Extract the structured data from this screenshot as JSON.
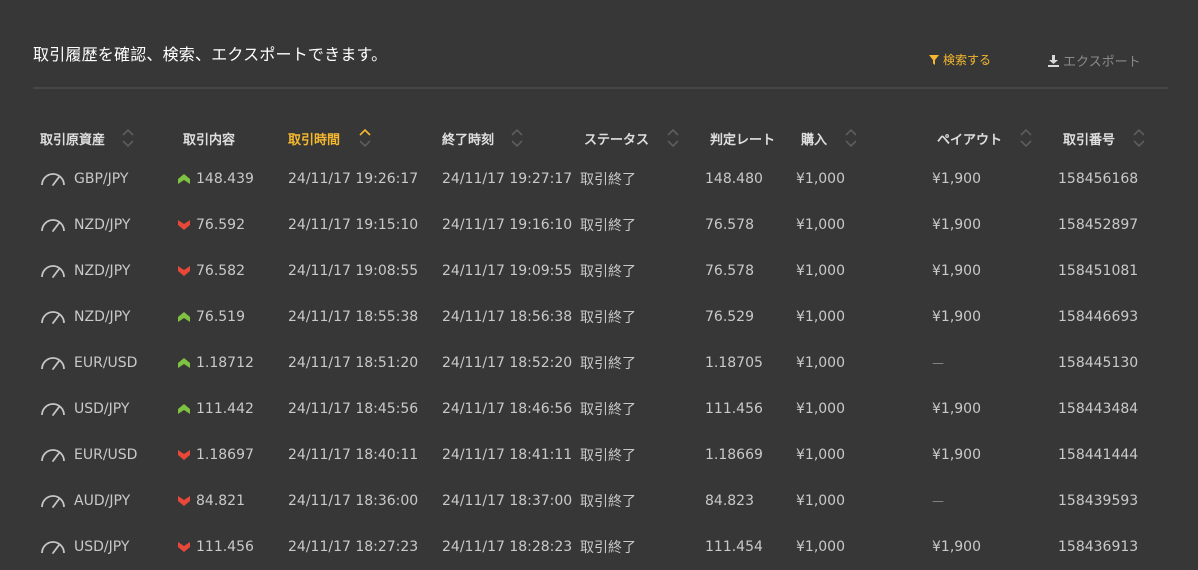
{
  "header": {
    "title": "取引履歴を確認、検索、エクスポートできます。",
    "search_label": "検索する",
    "export_label": "エクスポート"
  },
  "colors": {
    "accent": "#f5b82e",
    "up": "#7fc241",
    "down": "#e8483a"
  },
  "columns": [
    {
      "label": "取引原資産",
      "sortable": true,
      "active": false
    },
    {
      "label": "取引内容",
      "sortable": false,
      "active": false
    },
    {
      "label": "取引時間",
      "sortable": true,
      "active": true
    },
    {
      "label": "終了時刻",
      "sortable": true,
      "active": false
    },
    {
      "label": "ステータス",
      "sortable": true,
      "active": false
    },
    {
      "label": "判定レート",
      "sortable": false,
      "active": false
    },
    {
      "label": "購入",
      "sortable": true,
      "active": false
    },
    {
      "label": "ペイアウト",
      "sortable": true,
      "active": false
    },
    {
      "label": "取引番号",
      "sortable": true,
      "active": false
    }
  ],
  "rows": [
    {
      "asset": "GBP/JPY",
      "direction": "up",
      "entry": "148.439",
      "start": "24/11/17 19:26:17",
      "end": "24/11/17 19:27:17",
      "status": "取引終了",
      "rate": "148.480",
      "purchase": "¥1,000",
      "payout": "¥1,900",
      "id": "158456168"
    },
    {
      "asset": "NZD/JPY",
      "direction": "down",
      "entry": "76.592",
      "start": "24/11/17 19:15:10",
      "end": "24/11/17 19:16:10",
      "status": "取引終了",
      "rate": "76.578",
      "purchase": "¥1,000",
      "payout": "¥1,900",
      "id": "158452897"
    },
    {
      "asset": "NZD/JPY",
      "direction": "down",
      "entry": "76.582",
      "start": "24/11/17 19:08:55",
      "end": "24/11/17 19:09:55",
      "status": "取引終了",
      "rate": "76.578",
      "purchase": "¥1,000",
      "payout": "¥1,900",
      "id": "158451081"
    },
    {
      "asset": "NZD/JPY",
      "direction": "up",
      "entry": "76.519",
      "start": "24/11/17 18:55:38",
      "end": "24/11/17 18:56:38",
      "status": "取引終了",
      "rate": "76.529",
      "purchase": "¥1,000",
      "payout": "¥1,900",
      "id": "158446693"
    },
    {
      "asset": "EUR/USD",
      "direction": "up",
      "entry": "1.18712",
      "start": "24/11/17 18:51:20",
      "end": "24/11/17 18:52:20",
      "status": "取引終了",
      "rate": "1.18705",
      "purchase": "¥1,000",
      "payout": "—",
      "id": "158445130"
    },
    {
      "asset": "USD/JPY",
      "direction": "up",
      "entry": "111.442",
      "start": "24/11/17 18:45:56",
      "end": "24/11/17 18:46:56",
      "status": "取引終了",
      "rate": "111.456",
      "purchase": "¥1,000",
      "payout": "¥1,900",
      "id": "158443484"
    },
    {
      "asset": "EUR/USD",
      "direction": "down",
      "entry": "1.18697",
      "start": "24/11/17 18:40:11",
      "end": "24/11/17 18:41:11",
      "status": "取引終了",
      "rate": "1.18669",
      "purchase": "¥1,000",
      "payout": "¥1,900",
      "id": "158441444"
    },
    {
      "asset": "AUD/JPY",
      "direction": "down",
      "entry": "84.821",
      "start": "24/11/17 18:36:00",
      "end": "24/11/17 18:37:00",
      "status": "取引終了",
      "rate": "84.823",
      "purchase": "¥1,000",
      "payout": "—",
      "id": "158439593"
    },
    {
      "asset": "USD/JPY",
      "direction": "down",
      "entry": "111.456",
      "start": "24/11/17 18:27:23",
      "end": "24/11/17 18:28:23",
      "status": "取引終了",
      "rate": "111.454",
      "purchase": "¥1,000",
      "payout": "¥1,900",
      "id": "158436913"
    }
  ]
}
